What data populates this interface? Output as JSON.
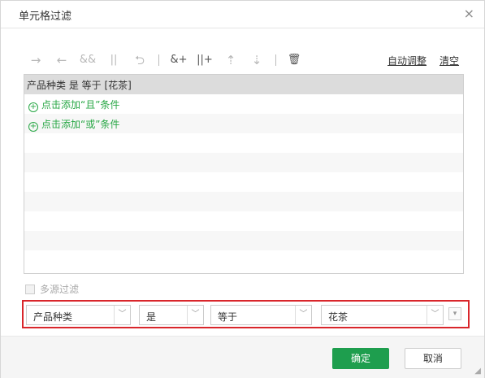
{
  "dialog": {
    "title": "单元格过滤",
    "close_glyph": "×"
  },
  "toolbar": {
    "icons": [
      {
        "name": "indent-right-icon",
        "glyph": "→"
      },
      {
        "name": "indent-left-icon",
        "glyph": "←"
      },
      {
        "name": "and-icon",
        "glyph": "&&"
      },
      {
        "name": "or-icon",
        "glyph": "||"
      },
      {
        "name": "swap-icon",
        "glyph": "⮌"
      },
      {
        "name": "add-and-icon",
        "glyph": "&+"
      },
      {
        "name": "add-or-icon",
        "glyph": "||+"
      },
      {
        "name": "move-up-icon",
        "glyph": "⇡"
      },
      {
        "name": "move-down-icon",
        "glyph": "⇣"
      },
      {
        "name": "delete-icon",
        "glyph": "🗑"
      }
    ],
    "auto_adjust": "自动调整",
    "clear": "清空"
  },
  "conditions": {
    "selected_row": "产品种类 是 等于 [花茶]",
    "add_and": "点击添加“且”条件",
    "add_or": "点击添加“或”条件"
  },
  "multi_source": {
    "label": "多源过滤",
    "checked": false
  },
  "editor": {
    "field": "产品种类",
    "is": "是",
    "operator": "等于",
    "value": "花茶"
  },
  "footer": {
    "ok": "确定",
    "cancel": "取消"
  },
  "colors": {
    "accent": "#1e9e4e",
    "highlight_border": "#d9262b",
    "add_link": "#28a745"
  }
}
